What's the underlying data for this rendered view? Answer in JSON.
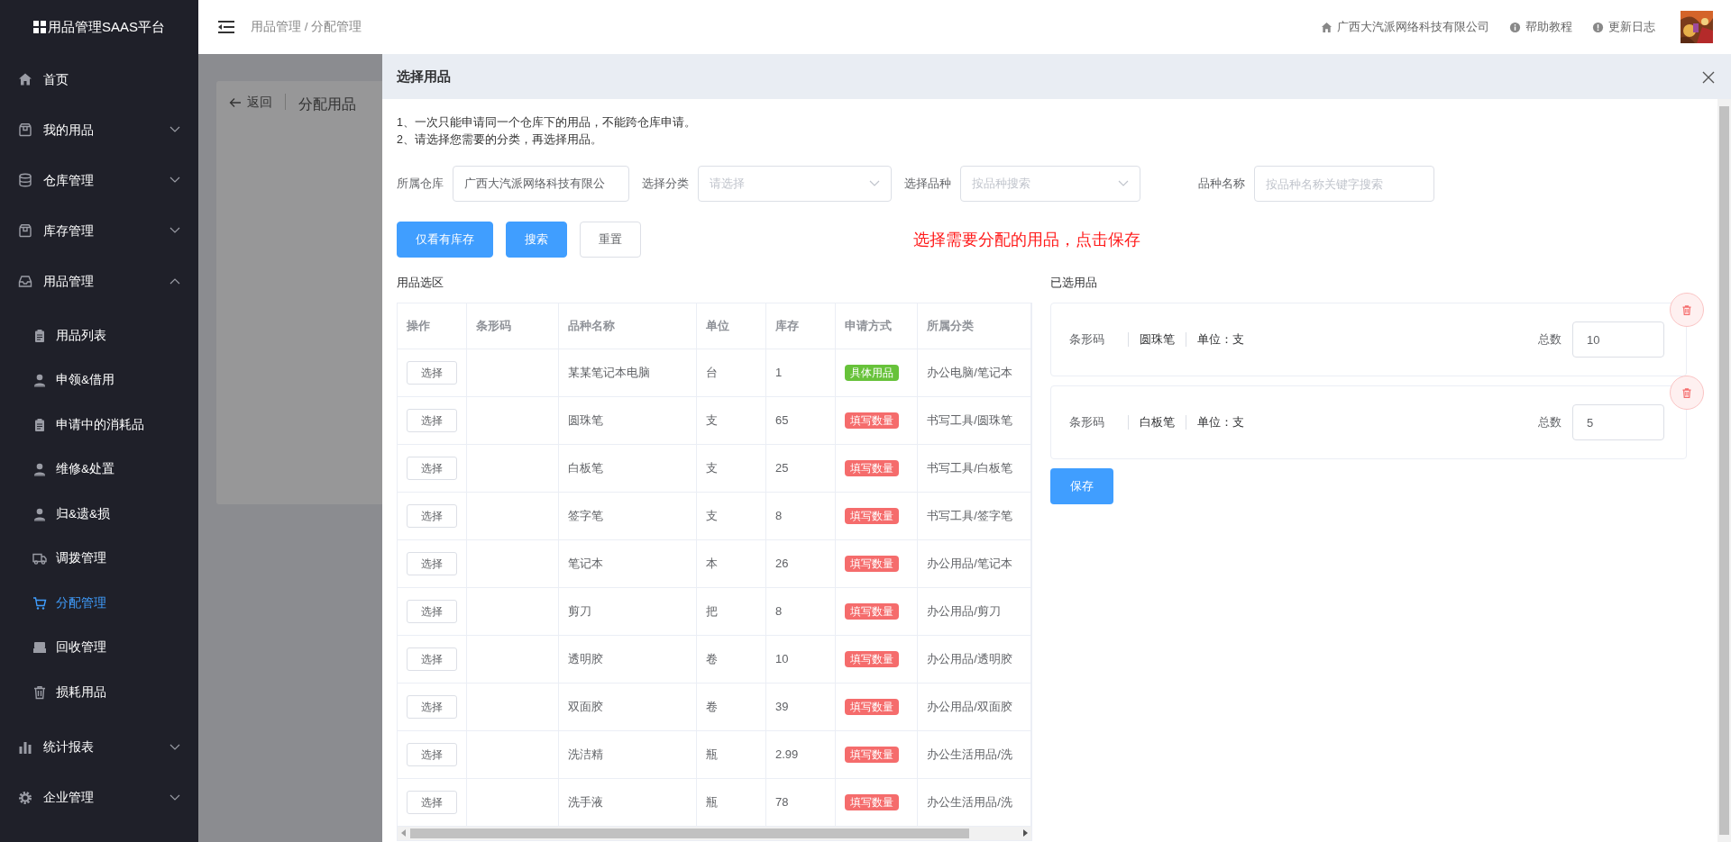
{
  "sidebar": {
    "logo": "用品管理SAAS平台",
    "items": [
      {
        "label": "首页",
        "selected": false
      },
      {
        "label": "我的用品",
        "selected": false,
        "expanded": false
      },
      {
        "label": "仓库管理",
        "selected": false,
        "expanded": false
      },
      {
        "label": "库存管理",
        "selected": false,
        "expanded": false
      },
      {
        "label": "用品管理",
        "selected": false,
        "expanded": true,
        "children": [
          {
            "label": "用品列表",
            "selected": false
          },
          {
            "label": "申领&借用",
            "selected": false
          },
          {
            "label": "申请中的消耗品",
            "selected": false
          },
          {
            "label": "维修&处置",
            "selected": false
          },
          {
            "label": "归&遗&损",
            "selected": false
          },
          {
            "label": "调拨管理",
            "selected": false
          },
          {
            "label": "分配管理",
            "selected": true
          },
          {
            "label": "回收管理",
            "selected": false
          },
          {
            "label": "损耗用品",
            "selected": false
          }
        ]
      },
      {
        "label": "统计报表",
        "selected": false,
        "expanded": false
      },
      {
        "label": "企业管理",
        "selected": false,
        "expanded": false
      }
    ]
  },
  "header": {
    "breadcrumb": "用品管理 / 分配管理",
    "links": [
      "广西大汽派网络科技有限公司",
      "帮助教程",
      "更新日志"
    ]
  },
  "background_page": {
    "back": "返回",
    "title": "分配用品"
  },
  "dialog": {
    "title": "选择用品",
    "notes": [
      "1、一次只能申请同一个仓库下的用品，不能跨仓库申请。",
      "2、请选择您需要的分类，再选择用品。"
    ],
    "filters": [
      {
        "label": "所属仓库",
        "kind": "input",
        "value": "广西大汽派网络科技有限公"
      },
      {
        "label": "选择分类",
        "kind": "select",
        "placeholder": "请选择"
      },
      {
        "label": "选择品种",
        "kind": "select",
        "placeholder": "按品种搜索"
      },
      {
        "label": "品种名称",
        "kind": "input",
        "placeholder": "按品种名称关键字搜索"
      }
    ],
    "buttons": [
      {
        "label": "仅看有库存",
        "kind": "primary"
      },
      {
        "label": "搜索",
        "kind": "primary"
      },
      {
        "label": "重置",
        "kind": "plain"
      }
    ],
    "hint": "选择需要分配的用品，点击保存",
    "picker": {
      "title": "用品选区",
      "columns": [
        "操作",
        "条形码",
        "品种名称",
        "单位",
        "库存",
        "申请方式",
        "所属分类"
      ],
      "rows": [
        {
          "action": "选择",
          "name": "某某笔记本电脑",
          "unit": "台",
          "stock": "1",
          "method": {
            "text": "具体用品",
            "color": "#67c23a"
          },
          "category": "办公电脑/笔记本"
        },
        {
          "action": "选择",
          "name": "圆珠笔",
          "unit": "支",
          "stock": "65",
          "method": {
            "text": "填写数量",
            "color": "#f56c6c"
          },
          "category": "书写工具/圆珠笔"
        },
        {
          "action": "选择",
          "name": "白板笔",
          "unit": "支",
          "stock": "25",
          "method": {
            "text": "填写数量",
            "color": "#f56c6c"
          },
          "category": "书写工具/白板笔"
        },
        {
          "action": "选择",
          "name": "签字笔",
          "unit": "支",
          "stock": "8",
          "method": {
            "text": "填写数量",
            "color": "#f56c6c"
          },
          "category": "书写工具/签字笔"
        },
        {
          "action": "选择",
          "name": "笔记本",
          "unit": "本",
          "stock": "26",
          "method": {
            "text": "填写数量",
            "color": "#f56c6c"
          },
          "category": "办公用品/笔记本"
        },
        {
          "action": "选择",
          "name": "剪刀",
          "unit": "把",
          "stock": "8",
          "method": {
            "text": "填写数量",
            "color": "#f56c6c"
          },
          "category": "办公用品/剪刀"
        },
        {
          "action": "选择",
          "name": "透明胶",
          "unit": "卷",
          "stock": "10",
          "method": {
            "text": "填写数量",
            "color": "#f56c6c"
          },
          "category": "办公用品/透明胶"
        },
        {
          "action": "选择",
          "name": "双面胶",
          "unit": "卷",
          "stock": "39",
          "method": {
            "text": "填写数量",
            "color": "#f56c6c"
          },
          "category": "办公用品/双面胶"
        },
        {
          "action": "选择",
          "name": "洗洁精",
          "unit": "瓶",
          "stock": "2.99",
          "method": {
            "text": "填写数量",
            "color": "#f56c6c"
          },
          "category": "办公生活用品/洗"
        },
        {
          "action": "选择",
          "name": "洗手液",
          "unit": "瓶",
          "stock": "78",
          "method": {
            "text": "填写数量",
            "color": "#f56c6c"
          },
          "category": "办公生活用品/洗"
        }
      ]
    },
    "selected_panel": {
      "title": "已选用品",
      "items": [
        {
          "barcode_label": "条形码",
          "name": "圆珠笔",
          "unit": "单位：支",
          "total_label": "总数",
          "total": "10"
        },
        {
          "barcode_label": "条形码",
          "name": "白板笔",
          "unit": "单位：支",
          "total_label": "总数",
          "total": "5"
        }
      ],
      "save": "保存"
    }
  }
}
